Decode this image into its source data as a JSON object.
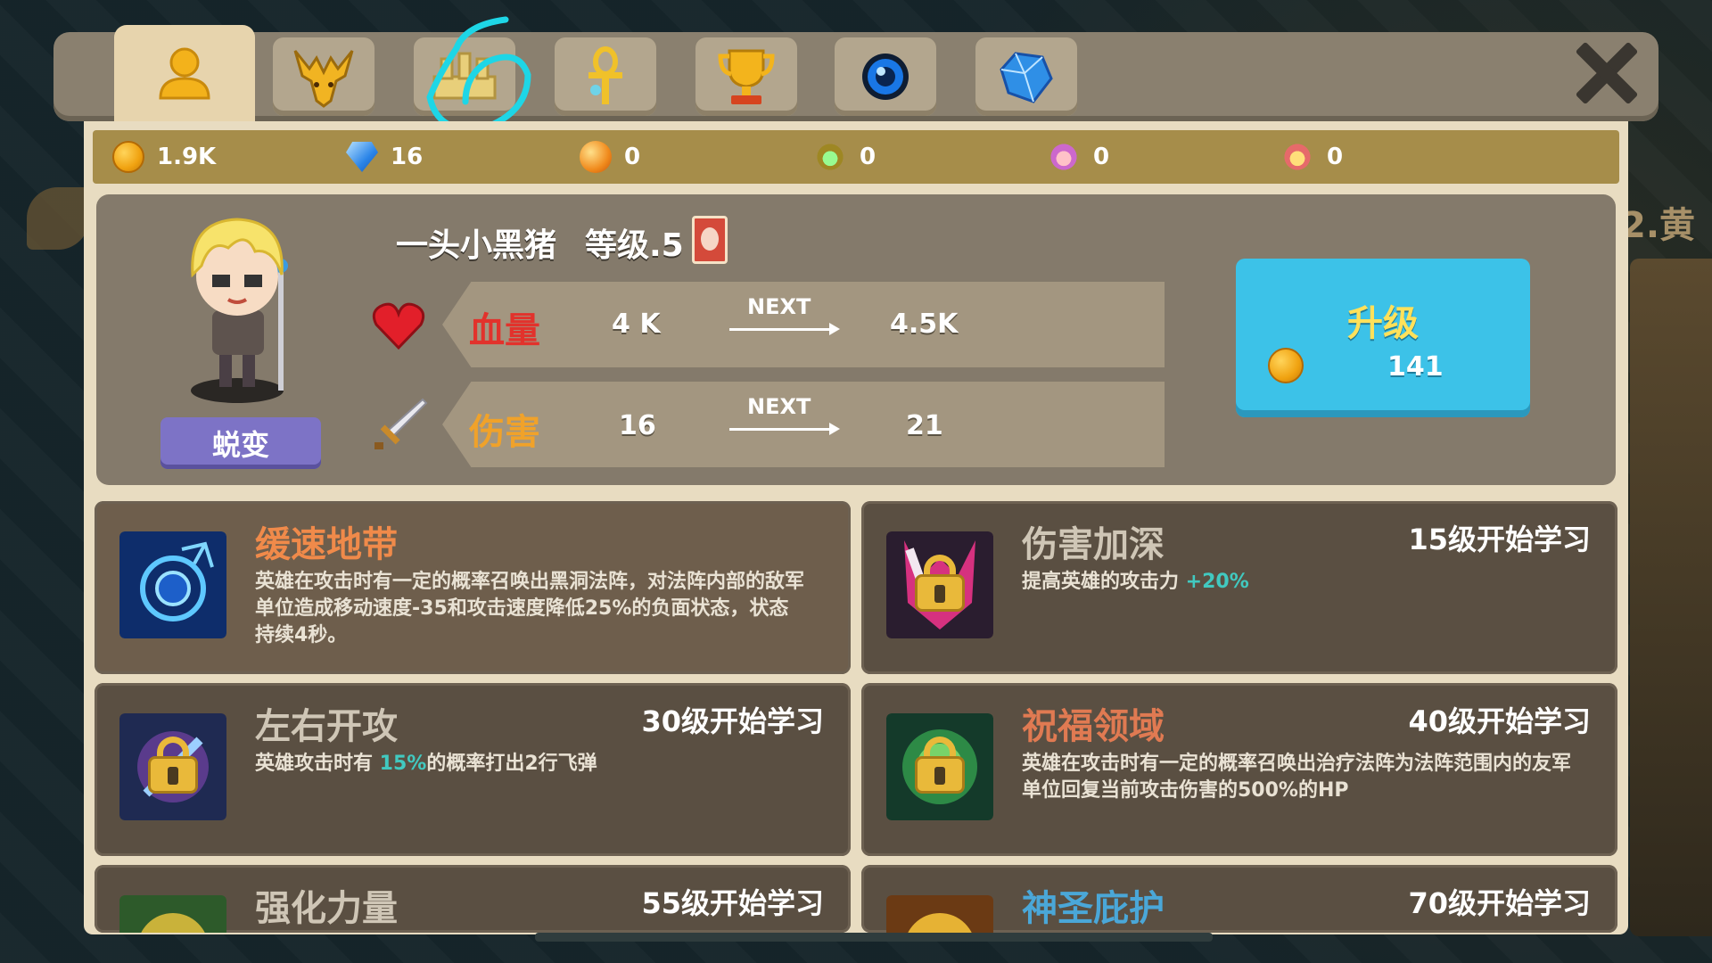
{
  "tabs": [
    {
      "name": "hero-tab",
      "icon": "person-icon",
      "active": true
    },
    {
      "name": "beast-tab",
      "icon": "deer-mask-icon",
      "active": false
    },
    {
      "name": "building-tab",
      "icon": "castle-icon",
      "active": false
    },
    {
      "name": "ankh-tab",
      "icon": "ankh-icon",
      "active": false
    },
    {
      "name": "trophy-tab",
      "icon": "trophy-icon",
      "active": false
    },
    {
      "name": "orb-tab",
      "icon": "blue-orb-icon",
      "active": false
    },
    {
      "name": "crystal-tab",
      "icon": "crystal-icon",
      "active": false
    }
  ],
  "currencies": [
    {
      "icon": "gold-coin-icon",
      "value": "1.9K"
    },
    {
      "icon": "diamond-icon",
      "value": "16"
    },
    {
      "icon": "orange-orb-icon",
      "value": "0"
    },
    {
      "icon": "yellow-monster-icon",
      "value": "0"
    },
    {
      "icon": "pink-monster-icon",
      "value": "0"
    },
    {
      "icon": "red-monster-icon",
      "value": "0"
    }
  ],
  "hero": {
    "name": "一头小黑猪",
    "level": "等级.5",
    "morph_label": "蜕变",
    "stats": [
      {
        "label": "血量",
        "current": "4 K",
        "next_label": "NEXT",
        "next": "4.5K",
        "color": "#e2322c",
        "icon": "heart-icon"
      },
      {
        "label": "伤害",
        "current": "16",
        "next_label": "NEXT",
        "next": "21",
        "color": "#f0a22a",
        "icon": "sword-icon"
      }
    ],
    "upgrade": {
      "label": "升级",
      "cost": "141"
    }
  },
  "skills": [
    {
      "name": "缓速地带",
      "name_color": "#f08a4a",
      "locked": false,
      "requirement": "",
      "desc": "英雄在攻击时有一定的概率召唤出黑洞法阵，对法阵内部的敌军单位造成移动速度-35和攻击速度降低25%的负面状态，状态持续4秒。",
      "desc_pre": "",
      "desc_hl": "",
      "desc_post": ""
    },
    {
      "name": "伤害加深",
      "name_color": "#cfc6b6",
      "locked": true,
      "requirement": "15级开始学习",
      "desc": "",
      "desc_pre": "提高英雄的攻击力 ",
      "desc_hl": "+20%",
      "desc_post": ""
    },
    {
      "name": "左右开攻",
      "name_color": "#cfc6b6",
      "locked": true,
      "requirement": "30级开始学习",
      "desc": "",
      "desc_pre": "英雄攻击时有 ",
      "desc_hl": "15%",
      "desc_post": "的概率打出2行飞弹"
    },
    {
      "name": "祝福领域",
      "name_color": "#e07a52",
      "locked": true,
      "requirement": "40级开始学习",
      "desc": "英雄在攻击时有一定的概率召唤出治疗法阵为法阵范围内的友军单位回复当前攻击伤害的500%的HP",
      "desc_pre": "",
      "desc_hl": "",
      "desc_post": ""
    },
    {
      "name": "强化力量",
      "name_color": "#cfc6b6",
      "locked": true,
      "requirement": "55级开始学习",
      "desc": "",
      "desc_pre": "",
      "desc_hl": "",
      "desc_post": ""
    },
    {
      "name": "神圣庇护",
      "name_color": "#4aa7d8",
      "locked": true,
      "requirement": "70级开始学习",
      "desc": "",
      "desc_pre": "",
      "desc_hl": "",
      "desc_post": ""
    }
  ],
  "background_text": "2.黄"
}
